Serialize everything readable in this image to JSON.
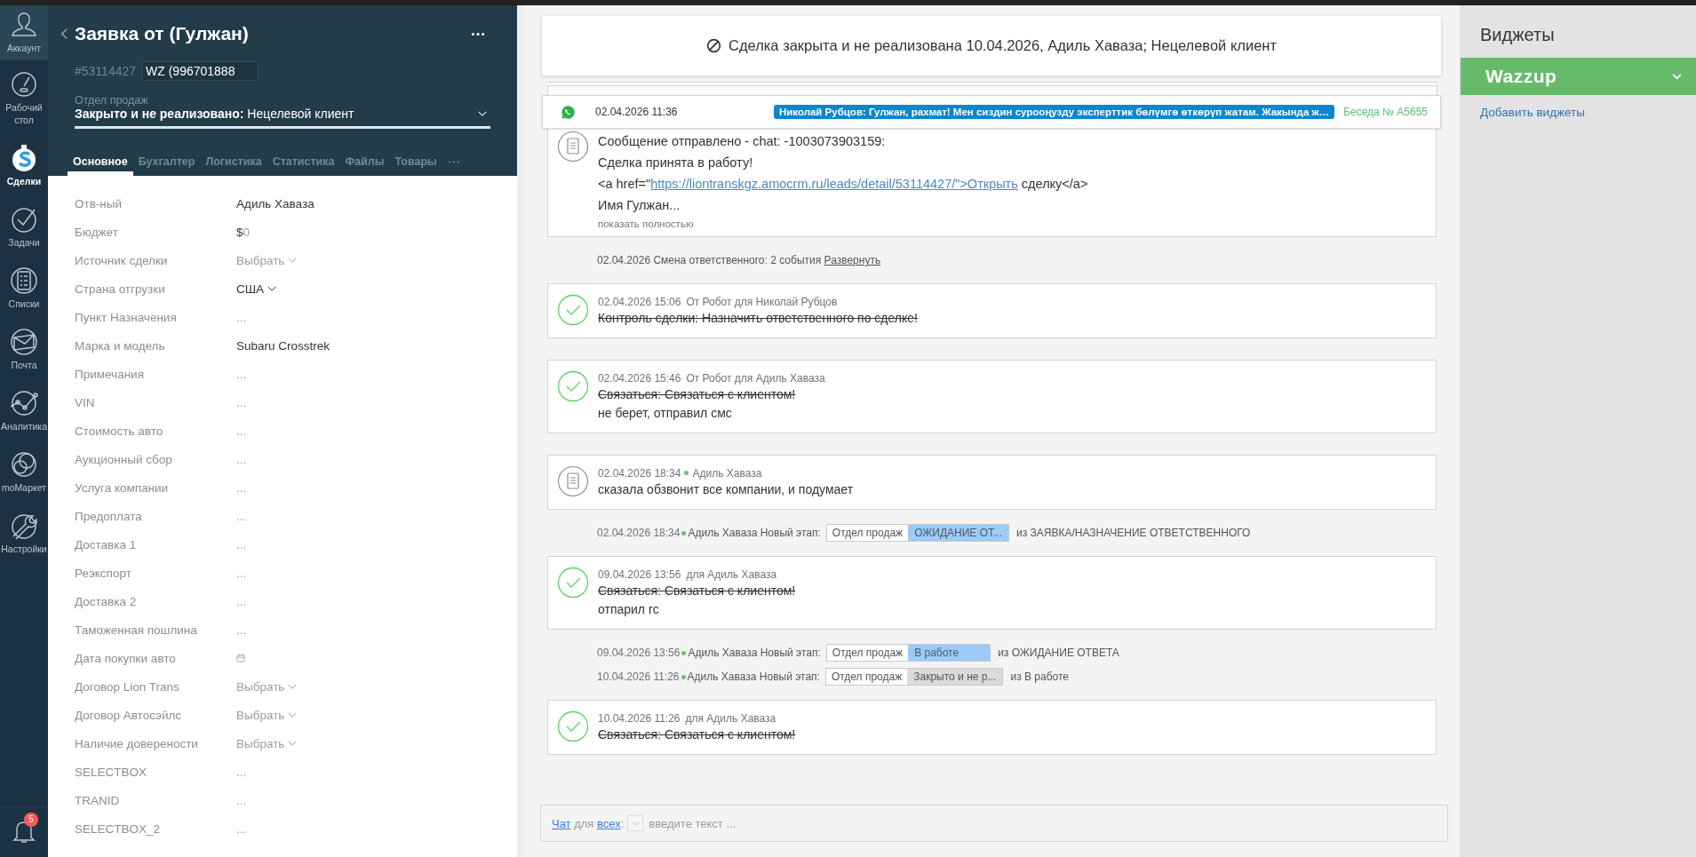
{
  "nav": {
    "items": [
      {
        "label": "Аккаунт",
        "selected": false
      },
      {
        "label": "Рабочий стол",
        "selected": false
      },
      {
        "label": "Сделки",
        "selected": true
      },
      {
        "label": "Задачи",
        "selected": false
      },
      {
        "label": "Списки",
        "selected": false
      },
      {
        "label": "Почта",
        "selected": false
      },
      {
        "label": "Аналитика",
        "selected": false
      },
      {
        "label": "moМаркет",
        "selected": false
      },
      {
        "label": "Настройки",
        "selected": false
      }
    ],
    "notifications": "5"
  },
  "lead": {
    "title": "Заявка от (Гулжан)",
    "id": "#53114427",
    "tag": "WZ (996701888",
    "pipeline": "Отдел продаж",
    "status_bold": "Закрыто и не реализовано:",
    "status": "Нецелевой клиент",
    "progress": {
      "level": 1
    },
    "tabs": [
      {
        "label": "Основное",
        "selected": true
      },
      {
        "label": "Бухгалтер",
        "selected": false
      },
      {
        "label": "Логистика",
        "selected": false
      },
      {
        "label": "Статистика",
        "selected": false
      },
      {
        "label": "Файлы",
        "selected": false
      },
      {
        "label": "Товары",
        "selected": false
      }
    ],
    "fields": [
      {
        "label": "Отв-ный",
        "kind": "text",
        "value": "Адиль Хаваза"
      },
      {
        "label": "Бюджет",
        "kind": "money",
        "currency": "$",
        "value": "0"
      },
      {
        "label": "Источник сделки",
        "kind": "select",
        "placeholder": "Выбрать"
      },
      {
        "label": "Страна отгрузки",
        "kind": "select",
        "value": "США"
      },
      {
        "label": "Пункт Назначения",
        "kind": "empty",
        "value": "..."
      },
      {
        "label": "Марка и модель",
        "kind": "text",
        "value": "Subaru Crosstrek"
      },
      {
        "label": "Примечания",
        "kind": "empty",
        "value": "..."
      },
      {
        "label": "VIN",
        "kind": "empty",
        "value": "..."
      },
      {
        "label": "Стоимость авто",
        "kind": "empty",
        "value": "..."
      },
      {
        "label": "Аукционный сбор",
        "kind": "empty",
        "value": "..."
      },
      {
        "label": "Услуга компании",
        "kind": "empty",
        "value": "..."
      },
      {
        "label": "Предоплата",
        "kind": "empty",
        "value": "..."
      },
      {
        "label": "Доставка 1",
        "kind": "empty",
        "value": "..."
      },
      {
        "label": "Реэкспорт",
        "kind": "empty",
        "value": "..."
      },
      {
        "label": "Доставка 2",
        "kind": "empty",
        "value": "..."
      },
      {
        "label": "Таможенная пошлина",
        "kind": "empty",
        "value": "..."
      },
      {
        "label": "Дата покупки авто",
        "kind": "date"
      },
      {
        "label": "Договор Lion Trans",
        "kind": "select",
        "placeholder": "Выбрать"
      },
      {
        "label": "Договор Автосэйлс",
        "kind": "select",
        "placeholder": "Выбрать"
      },
      {
        "label": "Наличие доверености",
        "kind": "select",
        "placeholder": "Выбрать"
      },
      {
        "label": "SELECTBOX",
        "kind": "empty",
        "value": "..."
      },
      {
        "label": "TRANID",
        "kind": "empty",
        "value": "..."
      },
      {
        "label": "SELECTBOX_2",
        "kind": "empty",
        "value": "..."
      }
    ]
  },
  "notice": {
    "text": "Сделка закрыта и не реализована 10.04.2026, Адиль Хаваза; Нецелевой клиент"
  },
  "whatsapp": {
    "time": "02.04.2026 11:36",
    "message": "Николай Рубцов: Гулжан, рахмат! Мен сиздин сурооңузду эксперттик бөлүмгө өткөрүп жатам. Жакында ж…",
    "chat": "Беседа № A5655"
  },
  "feed": [
    {
      "kind": "message",
      "lines": [
        {
          "kind": "text",
          "text": "Сообщение отправлено - chat: -1003073903159:"
        },
        {
          "kind": "text",
          "text": "Сделка принята в работу!"
        },
        {
          "kind": "link",
          "before": "<a href=\"",
          "link": "https://liontranskgz.amocrm.ru/leads/detail/53114427/\">Открыть",
          "after": " сделку</a>"
        },
        {
          "kind": "text",
          "text": "Имя Гулжан..."
        }
      ],
      "more": "показать полностью"
    },
    {
      "kind": "event",
      "text": "02.04.2026 Смена ответственного: 2 события",
      "link": "Развернуть"
    },
    {
      "kind": "task",
      "date": "02.04.2026 15:06",
      "author": "От Робот для Николай Рубцов",
      "online": false,
      "done": true,
      "title": "Контроль сделки: Назначить ответственного по сделке!"
    },
    {
      "kind": "task",
      "date": "02.04.2026 15:46",
      "author": "От Робот для Адиль Хаваза",
      "online": false,
      "done": true,
      "title": "Связаться: Связаться с клиентом!",
      "result": "не берет, отправил смс"
    },
    {
      "kind": "note",
      "date": "02.04.2026 18:34",
      "author": "Адиль Хаваза",
      "online": true,
      "text": "сказала обзвонит все компании, и подумает"
    },
    {
      "kind": "stage",
      "date": "02.04.2026 18:34",
      "author": "Адиль Хаваза Новый этап:",
      "online": true,
      "pipeline": "Отдел продаж",
      "stage": "ОЖИДАНИЕ ОТ...",
      "color": "#9dcbf7",
      "from": "из ЗАЯВКА/НАЗНАЧЕНИЕ ОТВЕТСТВЕННОГО"
    },
    {
      "kind": "task",
      "date": "09.04.2026 13:56",
      "author": "для Адиль Хаваза",
      "online": false,
      "done": true,
      "title": "Связаться: Связаться с клиентом!",
      "result": "отпарил гс"
    },
    {
      "kind": "stage",
      "date": "09.04.2026 13:56",
      "author": "Адиль Хаваза Новый этап:",
      "online": true,
      "pipeline": "Отдел продаж",
      "stage": "В работе",
      "color": "#9dcbf7",
      "from": "из ОЖИДАНИЕ ОТВЕТА"
    },
    {
      "kind": "stage",
      "date": "10.04.2026 11:26",
      "author": "Адиль Хаваза Новый этап:",
      "online": true,
      "pipeline": "Отдел продаж",
      "stage": "Закрыто и не р...",
      "color": "#dadada",
      "from": "из В работе"
    },
    {
      "kind": "task",
      "date": "10.04.2026 11:26",
      "author": "для Адиль Хаваза",
      "online": false,
      "done": true,
      "title": "Связаться: Связаться с клиентом!"
    }
  ],
  "chat": {
    "channel": "Чат",
    "for": "для",
    "recipient": "всех",
    "separator": ":",
    "placeholder": "введите текст ..."
  },
  "widgets": {
    "title": "Виджеты",
    "items": [
      {
        "name": "Wazzup"
      }
    ],
    "add": "Добавить виджеты"
  }
}
